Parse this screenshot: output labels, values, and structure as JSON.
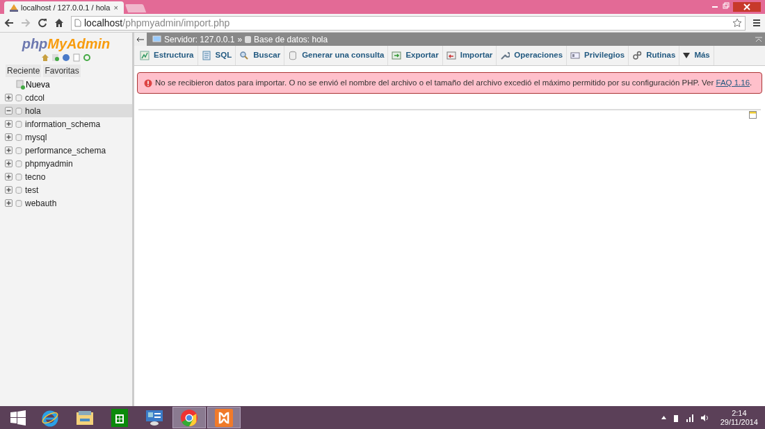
{
  "browser": {
    "tab_title": "localhost / 127.0.0.1 / hola",
    "tab_close": "×",
    "url": {
      "host": "localhost",
      "path": "/phpmyadmin/import.php"
    }
  },
  "sidebar": {
    "logo": {
      "part_1": "php",
      "part_2": "MyAdmin"
    },
    "tabs": [
      "Reciente",
      "Favoritas"
    ],
    "tree": [
      {
        "kind": "new",
        "label": "Nueva"
      },
      {
        "kind": "db",
        "label": "cdcol",
        "expanded": false,
        "selected": false
      },
      {
        "kind": "db",
        "label": "hola",
        "expanded": true,
        "selected": true
      },
      {
        "kind": "db",
        "label": "information_schema",
        "expanded": false,
        "selected": false
      },
      {
        "kind": "db",
        "label": "mysql",
        "expanded": false,
        "selected": false
      },
      {
        "kind": "db",
        "label": "performance_schema",
        "expanded": false,
        "selected": false
      },
      {
        "kind": "db",
        "label": "phpmyadmin",
        "expanded": false,
        "selected": false
      },
      {
        "kind": "db",
        "label": "tecno",
        "expanded": false,
        "selected": false
      },
      {
        "kind": "db",
        "label": "test",
        "expanded": false,
        "selected": false
      },
      {
        "kind": "db",
        "label": "webauth",
        "expanded": false,
        "selected": false
      }
    ]
  },
  "breadcrumb": {
    "server": "Servidor: 127.0.0.1",
    "separator": "»",
    "database": "Base de datos: hola"
  },
  "menu_tabs": [
    {
      "kind": "structure",
      "label": "Estructura"
    },
    {
      "kind": "sql",
      "label": "SQL"
    },
    {
      "kind": "search",
      "label": "Buscar"
    },
    {
      "kind": "query",
      "label": "Generar una consulta"
    },
    {
      "kind": "export",
      "label": "Exportar"
    },
    {
      "kind": "import",
      "label": "Importar"
    },
    {
      "kind": "operations",
      "label": "Operaciones"
    },
    {
      "kind": "privileges",
      "label": "Privilegios"
    },
    {
      "kind": "routines",
      "label": "Rutinas"
    },
    {
      "kind": "more",
      "label": "Más"
    }
  ],
  "error": {
    "text": "No se recibieron datos para importar. O no se envió el nombre del archivo o el tamaño del archivo excedió el máximo permitido por su configuración PHP. Ver",
    "link": "FAQ 1.16",
    "trail": "."
  },
  "taskbar": {
    "apps": [
      {
        "kind": "ie",
        "selected": false
      },
      {
        "kind": "explorer",
        "selected": false
      },
      {
        "kind": "store",
        "selected": false
      },
      {
        "kind": "control",
        "selected": false
      },
      {
        "kind": "chrome",
        "selected": true
      },
      {
        "kind": "xampp",
        "selected": true
      }
    ],
    "time": "2:14",
    "date": "29/11/2014"
  }
}
